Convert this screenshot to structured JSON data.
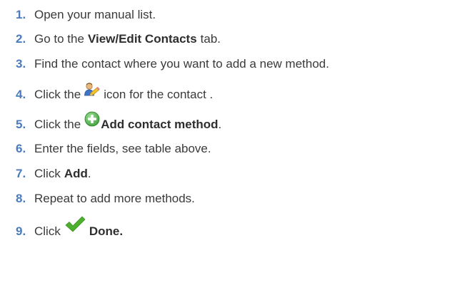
{
  "steps": [
    {
      "num": "1.",
      "text": "Open your manual list."
    },
    {
      "num": "2.",
      "before": "Go to the",
      "bold": "View/Edit Contacts",
      "after": "tab."
    },
    {
      "num": "3.",
      "text": "Find the contact where you want to add a new method."
    },
    {
      "num": "4.",
      "before": "Click the",
      "icon": "edit-contact-icon",
      "after": "icon for the contact ."
    },
    {
      "num": "5.",
      "before": "Click the",
      "icon": "add-plus-icon",
      "bold": "Add contact method",
      "after": "."
    },
    {
      "num": "6.",
      "text": "Enter the fields, see table above."
    },
    {
      "num": "7.",
      "before": "Click",
      "bold": "Add",
      "after": "."
    },
    {
      "num": "8.",
      "text": "Repeat to add more methods."
    },
    {
      "num": "9.",
      "before": "Click",
      "icon": "checkmark-icon",
      "bold": "Done."
    }
  ],
  "colors": {
    "number": "#4b7bbd",
    "text": "#3a3a3a",
    "plus_icon": "#5cb85c",
    "check_icon": "#4caf2e"
  }
}
